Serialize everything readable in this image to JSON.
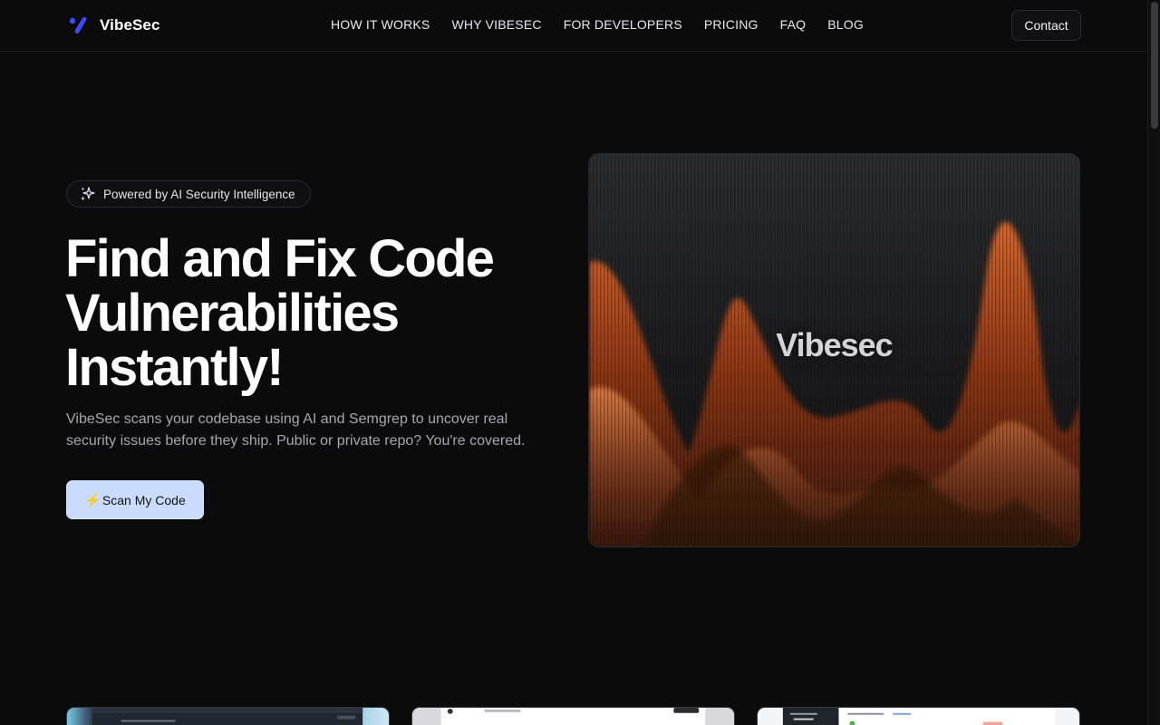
{
  "brand": {
    "name": "VibeSec"
  },
  "nav": {
    "items": [
      {
        "label": "HOW IT WORKS"
      },
      {
        "label": "WHY VIBESEC"
      },
      {
        "label": "FOR DEVELOPERS"
      },
      {
        "label": "PRICING"
      },
      {
        "label": "FAQ"
      },
      {
        "label": "BLOG"
      }
    ],
    "contact_label": "Contact"
  },
  "hero": {
    "badge_text": "Powered by AI Security Intelligence",
    "title_lines": [
      "Find and Fix Code",
      "Vulnerabilities",
      "Instantly!"
    ],
    "description": "VibeSec scans your codebase using AI and Semgrep to uncover real security issues before they ship. Public or private repo? You're covered.",
    "cta_icon": "⚡",
    "cta_label": "Scan My Code",
    "visual_brand": "Vibesec"
  },
  "icons": {
    "logo": "vibesec-logo-icon",
    "badge": "sparkles-icon",
    "cta": "lightning-icon"
  },
  "colors": {
    "background": "#0b0b0c",
    "accent": "#3d4bff",
    "cta_background": "#c9dcfd",
    "flame": "#d2541b"
  }
}
